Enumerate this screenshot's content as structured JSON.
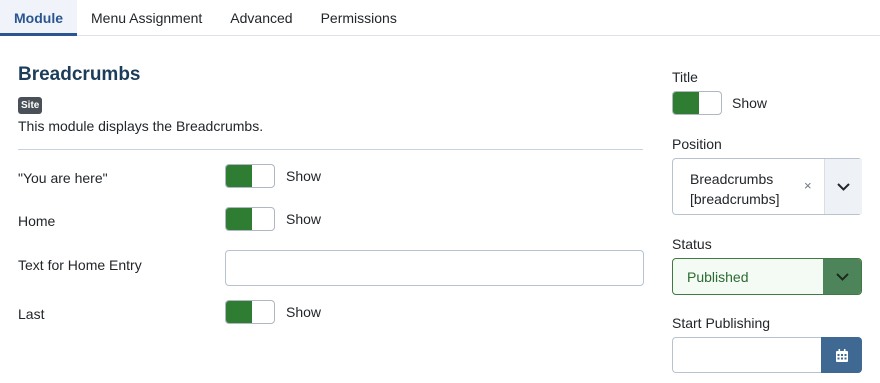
{
  "tabs": [
    {
      "label": "Module",
      "active": true
    },
    {
      "label": "Menu Assignment",
      "active": false
    },
    {
      "label": "Advanced",
      "active": false
    },
    {
      "label": "Permissions",
      "active": false
    }
  ],
  "module": {
    "title": "Breadcrumbs",
    "badge": "Site",
    "description": "This module displays the Breadcrumbs."
  },
  "fields": {
    "you_are_here": {
      "label": "\"You are here\"",
      "state": "Show"
    },
    "home": {
      "label": "Home",
      "state": "Show"
    },
    "home_entry": {
      "label": "Text for Home Entry",
      "value": "",
      "placeholder": ""
    },
    "last": {
      "label": "Last",
      "state": "Show"
    }
  },
  "sidebar": {
    "title": {
      "label": "Title",
      "state": "Show"
    },
    "position": {
      "label": "Position",
      "value_line1": "Breadcrumbs",
      "value_line2": "[breadcrumbs]",
      "clear": "×"
    },
    "status": {
      "label": "Status",
      "value": "Published"
    },
    "start_publishing": {
      "label": "Start Publishing",
      "value": ""
    }
  },
  "colors": {
    "accent": "#2a5591",
    "switch_on": "#2f7d32",
    "status_green": "#4e845a",
    "calendar_button": "#3f6893"
  },
  "icons": {
    "position_dropdown": "chevron-down-icon",
    "status_dropdown": "chevron-down-icon",
    "calendar": "calendar-icon"
  }
}
